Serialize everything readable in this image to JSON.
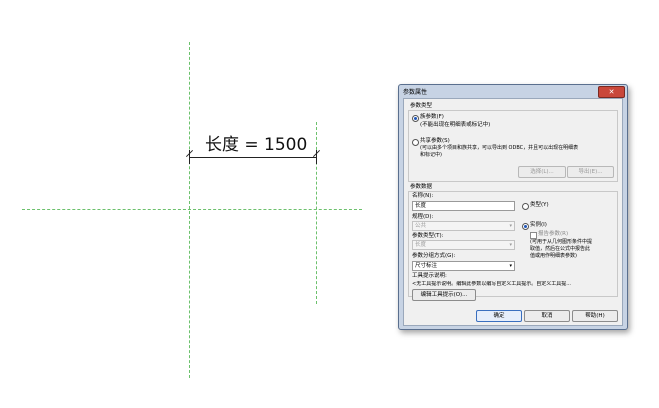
{
  "canvas": {
    "dimension_text": "长度 = 1500"
  },
  "dialog": {
    "title": "参数属性",
    "close_label": "✕",
    "param_type": {
      "group_label": "参数类型",
      "family_param_label": "族参数(F)",
      "family_param_note": "(不能出现在明细表或标记中)",
      "shared_param_label": "共享参数(S)",
      "shared_param_note1": "(可以由多个项目和族共享，可以导出到 ODBC，并且可以出现在明细表",
      "shared_param_note2": "和标记中)",
      "select_button": "选择(L)...",
      "export_button": "导出(E)..."
    },
    "param_data": {
      "group_label": "参数数据",
      "name_label": "名称(N):",
      "name_value": "长度",
      "type_radio_label": "类型(Y)",
      "discipline_label": "规程(D):",
      "discipline_value": "公共",
      "instance_radio_label": "实例(I)",
      "param_type_label": "参数类型(T):",
      "param_type_value": "长度",
      "report_param_label": "报告参数(R)",
      "report_note1": "(可用于从几何图形条件中提",
      "report_note2": "取值，然后在公式中报告此",
      "report_note3": "值或用作明细表参数)",
      "group_by_label": "参数分组方式(G):",
      "group_by_value": "尺寸标注",
      "tooltip_label": "工具提示说明:",
      "tooltip_value": "<无工具提示说明。编辑此参数以编写自定义工具提示。自定义工具提...",
      "edit_tooltip_button": "编辑工具提示(O)..."
    },
    "buttons": {
      "ok": "确定",
      "cancel": "取消",
      "help": "帮助(H)"
    }
  }
}
